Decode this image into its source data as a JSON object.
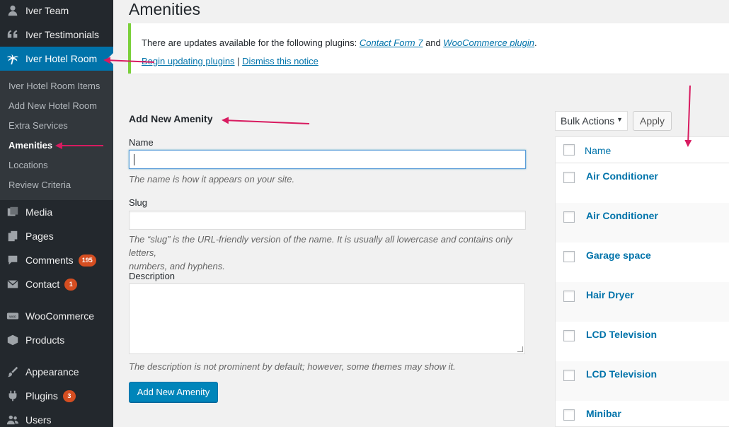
{
  "sidebar": {
    "items": [
      {
        "label": "Iver Team",
        "icon": "person-icon"
      },
      {
        "label": "Iver Testimonials",
        "icon": "quote-icon"
      },
      {
        "label": "Iver Hotel Room",
        "icon": "palm-tree-icon"
      },
      {
        "label": "Media",
        "icon": "media-icon"
      },
      {
        "label": "Pages",
        "icon": "pages-icon"
      },
      {
        "label": "Comments",
        "icon": "comment-icon",
        "badge": "195"
      },
      {
        "label": "Contact",
        "icon": "mail-icon",
        "badge": "1"
      },
      {
        "label": "WooCommerce",
        "icon": "woo-icon"
      },
      {
        "label": "Products",
        "icon": "box-icon"
      },
      {
        "label": "Appearance",
        "icon": "brush-icon"
      },
      {
        "label": "Plugins",
        "icon": "plug-icon",
        "badge": "3"
      },
      {
        "label": "Users",
        "icon": "users-icon"
      }
    ],
    "submenu": [
      "Iver Hotel Room Items",
      "Add New Hotel Room",
      "Extra Services",
      "Amenities",
      "Locations",
      "Review Criteria"
    ]
  },
  "page": {
    "title": "Amenities"
  },
  "notice": {
    "text_prefix": "There are updates available for the following plugins: ",
    "plugin1": "Contact Form 7",
    "and": " and ",
    "plugin2": "WooCommerce plugin",
    "period": ".",
    "begin_link": "Begin updating plugins",
    "separator": " | ",
    "dismiss_link": "Dismiss this notice"
  },
  "form": {
    "title": "Add New Amenity",
    "name_label": "Name",
    "name_value": "",
    "name_help": "The name is how it appears on your site.",
    "slug_label": "Slug",
    "slug_value": "",
    "slug_help_1": "The “slug” is the URL-friendly version of the name. It is usually all lowercase and contains only letters,",
    "slug_help_2": "numbers, and hyphens.",
    "desc_label": "Description",
    "desc_value": "",
    "desc_help": "The description is not prominent by default; however, some themes may show it.",
    "submit": "Add New Amenity"
  },
  "table": {
    "bulk_actions": "Bulk Actions",
    "apply": "Apply",
    "column_name": "Name",
    "rows": [
      "Air Conditioner",
      "Air Conditioner",
      "Garage space",
      "Hair Dryer",
      "LCD Television",
      "LCD Television",
      "Minibar"
    ]
  },
  "colors": {
    "sidebar_bg": "#23282d",
    "active_bg": "#0073aa",
    "badge_bg": "#d54e21",
    "notice_border": "#7ad03a",
    "annotation_arrow": "#d81b60"
  }
}
